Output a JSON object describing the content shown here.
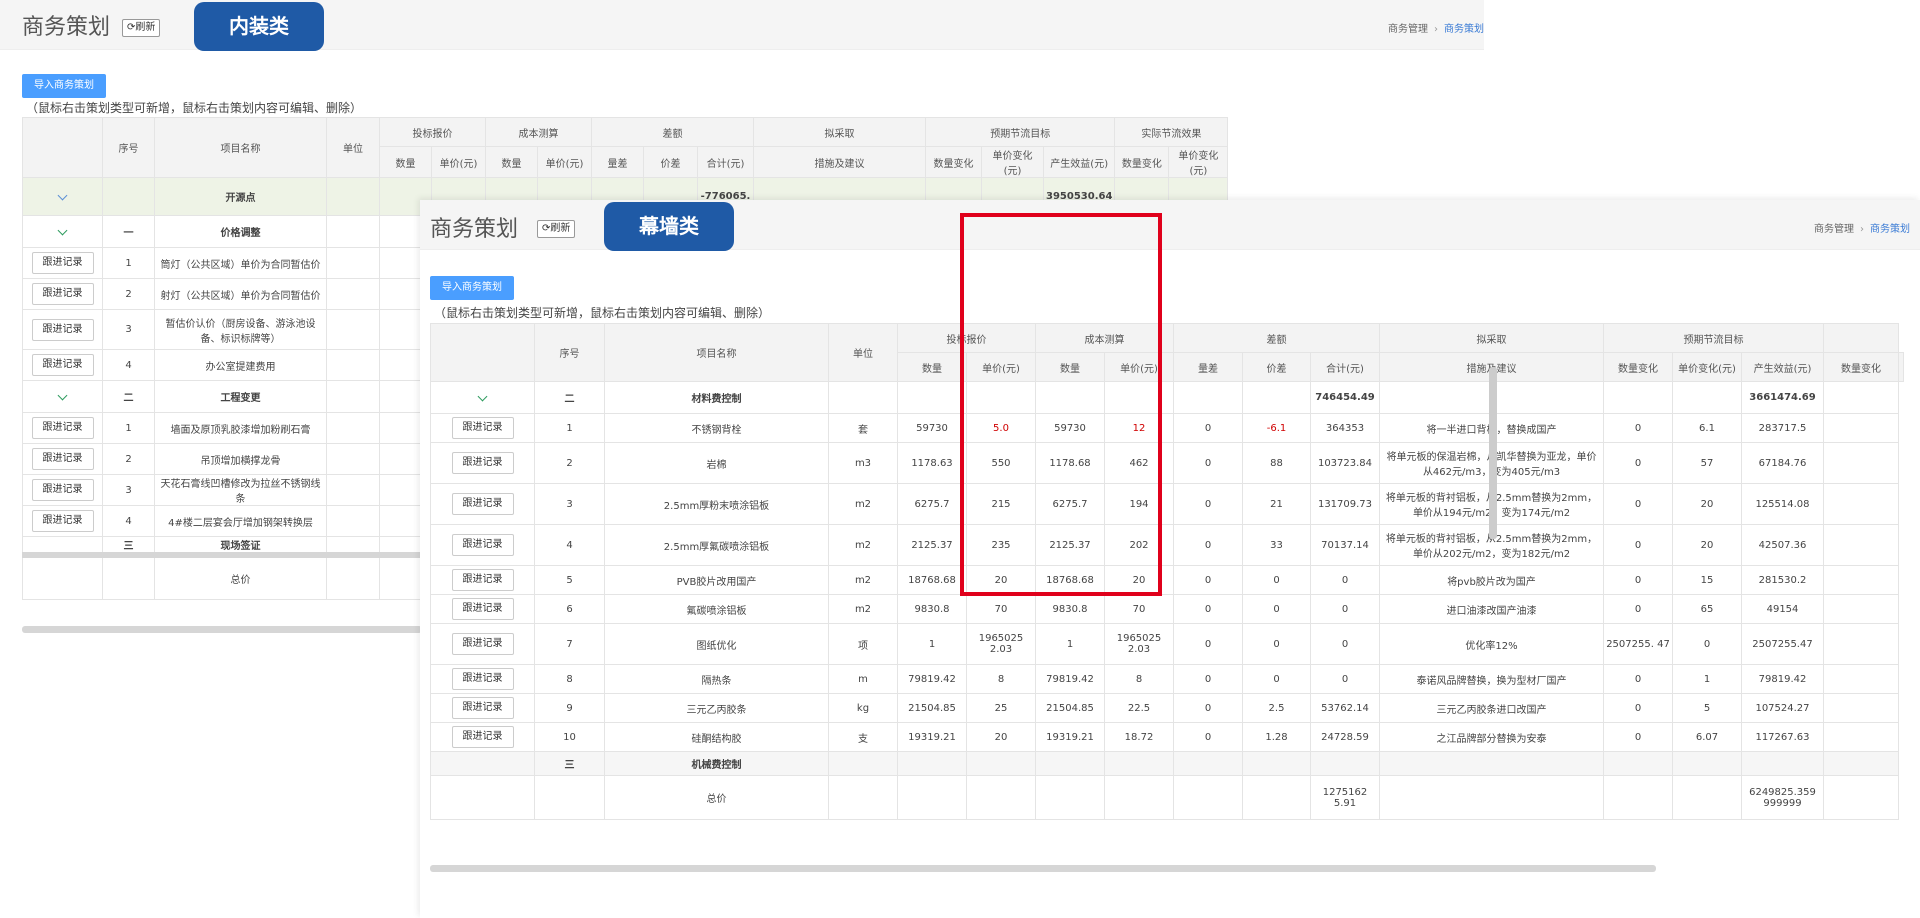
{
  "back": {
    "title": "商务策划",
    "refresh": "⟳刷新",
    "category": "内装类",
    "breadcrumb": [
      "商务管理",
      "商务策划"
    ],
    "import_label": "导入商务策划",
    "hint": "（鼠标右击策划类型可新增，鼠标右击策划内容可编辑、删除）",
    "headers": {
      "seq": "序号",
      "name": "项目名称",
      "unit": "单位",
      "groups": [
        "投标报价",
        "成本测算",
        "差额",
        "拟采取",
        "预期节流目标",
        "实际节流效果"
      ],
      "sub": [
        "数量",
        "单价(元)",
        "数量",
        "单价(元)",
        "量差",
        "价差",
        "合计(元)",
        "措施及建议",
        "数量变化",
        "单价变化(元)",
        "产生效益(元)",
        "数量变化",
        "单价变化(元)"
      ]
    },
    "top_row": {
      "name": "开源点",
      "total": "-776065.",
      "benefit": "3950530.64"
    },
    "rows": [
      {
        "kind": "group",
        "seq": "一",
        "name": "价格调整"
      },
      {
        "kind": "item",
        "btn": "跟进记录",
        "seq": "1",
        "name": "筒灯（公共区域）单价为合同暂估价"
      },
      {
        "kind": "item",
        "btn": "跟进记录",
        "seq": "2",
        "name": "射灯（公共区域）单价为合同暂估价"
      },
      {
        "kind": "item",
        "btn": "跟进记录",
        "seq": "3",
        "name": "暂估价认价（厨房设备、游泳池设备、标识标牌等）"
      },
      {
        "kind": "item",
        "btn": "跟进记录",
        "seq": "4",
        "name": "办公室提建费用"
      },
      {
        "kind": "group",
        "seq": "二",
        "name": "工程变更"
      },
      {
        "kind": "item",
        "btn": "跟进记录",
        "seq": "1",
        "name": "墙面及原顶乳胶漆增加粉刷石膏"
      },
      {
        "kind": "item",
        "btn": "跟进记录",
        "seq": "2",
        "name": "吊顶增加横撑龙骨"
      },
      {
        "kind": "item",
        "btn": "跟进记录",
        "seq": "3",
        "name": "天花石膏线凹槽修改为拉丝不锈钢线条"
      },
      {
        "kind": "item",
        "btn": "跟进记录",
        "seq": "4",
        "name": "4#楼二层宴会厅增加钢架转换层"
      },
      {
        "kind": "cut",
        "seq": "三",
        "name": "现场签证"
      }
    ],
    "total_label": "总价"
  },
  "front": {
    "title": "商务策划",
    "refresh": "⟳刷新",
    "category": "幕墙类",
    "breadcrumb": [
      "商务管理",
      "商务策划"
    ],
    "import_label": "导入商务策划",
    "hint": "（鼠标右击策划类型可新增，鼠标右击策划内容可编辑、删除）",
    "headers": {
      "seq": "序号",
      "name": "项目名称",
      "unit": "单位",
      "groups": [
        "投标报价",
        "成本测算",
        "差额",
        "拟采取",
        "预期节流目标"
      ],
      "sub": [
        "数量",
        "单价(元)",
        "数量",
        "单价(元)",
        "量差",
        "价差",
        "合计(元)",
        "措施及建议",
        "数量变化",
        "单价变化(元)",
        "产生效益(元)",
        "数量变化"
      ]
    },
    "section": {
      "seq": "二",
      "name": "材料费控制",
      "total": "746454.49",
      "benefit": "3661474.69"
    },
    "rows": [
      {
        "btn": "跟进记录",
        "seq": "1",
        "name": "不锈钢背栓",
        "unit": "套",
        "bid_qty": "59730",
        "bid_price": "5.0",
        "cost_qty": "59730",
        "cost_price": "12",
        "qty_diff": "0",
        "price_diff": "-6.1",
        "total": "364353",
        "measure": "将一半进口背栓，替换成国产",
        "qty_chg": "0",
        "price_chg": "6.1",
        "benefit": "283717.5",
        "red": true
      },
      {
        "btn": "跟进记录",
        "seq": "2",
        "name": "岩棉",
        "unit": "m3",
        "bid_qty": "1178.63",
        "bid_price": "550",
        "cost_qty": "1178.68",
        "cost_price": "462",
        "qty_diff": "0",
        "price_diff": "88",
        "total": "103723.84",
        "measure": "将单元板的保温岩棉，从凯华替换为亚龙，单价从462元/m3，变为405元/m3",
        "qty_chg": "0",
        "price_chg": "57",
        "benefit": "67184.76"
      },
      {
        "btn": "跟进记录",
        "seq": "3",
        "name": "2.5mm厚粉末喷涂铝板",
        "unit": "m2",
        "bid_qty": "6275.7",
        "bid_price": "215",
        "cost_qty": "6275.7",
        "cost_price": "194",
        "qty_diff": "0",
        "price_diff": "21",
        "total": "131709.73",
        "measure": "将单元板的背衬铝板，从2.5mm替换为2mm，单价从194元/m2，变为174元/m2",
        "qty_chg": "0",
        "price_chg": "20",
        "benefit": "125514.08"
      },
      {
        "btn": "跟进记录",
        "seq": "4",
        "name": "2.5mm厚氟碳喷涂铝板",
        "unit": "m2",
        "bid_qty": "2125.37",
        "bid_price": "235",
        "cost_qty": "2125.37",
        "cost_price": "202",
        "qty_diff": "0",
        "price_diff": "33",
        "total": "70137.14",
        "measure": "将单元板的背衬铝板，从2.5mm替换为2mm，单价从202元/m2，变为182元/m2",
        "qty_chg": "0",
        "price_chg": "20",
        "benefit": "42507.36"
      },
      {
        "btn": "跟进记录",
        "seq": "5",
        "name": "PVB胶片改用国产",
        "unit": "m2",
        "bid_qty": "18768.68",
        "bid_price": "20",
        "cost_qty": "18768.68",
        "cost_price": "20",
        "qty_diff": "0",
        "price_diff": "0",
        "total": "0",
        "measure": "将pvb胶片改为国产",
        "qty_chg": "0",
        "price_chg": "15",
        "benefit": "281530.2"
      },
      {
        "btn": "跟进记录",
        "seq": "6",
        "name": "氟碳喷涂铝板",
        "unit": "m2",
        "bid_qty": "9830.8",
        "bid_price": "70",
        "cost_qty": "9830.8",
        "cost_price": "70",
        "qty_diff": "0",
        "price_diff": "0",
        "total": "0",
        "measure": "进口油漆改国产油漆",
        "qty_chg": "0",
        "price_chg": "65",
        "benefit": "49154"
      },
      {
        "btn": "跟进记录",
        "seq": "7",
        "name": "图纸优化",
        "unit": "项",
        "bid_qty": "1",
        "bid_price": "1965025 2.03",
        "cost_qty": "1",
        "cost_price": "1965025 2.03",
        "qty_diff": "0",
        "price_diff": "0",
        "total": "0",
        "measure": "优化率12%",
        "qty_chg": "2507255. 47",
        "price_chg": "0",
        "benefit": "2507255.47"
      },
      {
        "btn": "跟进记录",
        "seq": "8",
        "name": "隔热条",
        "unit": "m",
        "bid_qty": "79819.42",
        "bid_price": "8",
        "cost_qty": "79819.42",
        "cost_price": "8",
        "qty_diff": "0",
        "price_diff": "0",
        "total": "0",
        "measure": "泰诺风品牌替换，换为型材厂国产",
        "qty_chg": "0",
        "price_chg": "1",
        "benefit": "79819.42"
      },
      {
        "btn": "跟进记录",
        "seq": "9",
        "name": "三元乙丙胶条",
        "unit": "kg",
        "bid_qty": "21504.85",
        "bid_price": "25",
        "cost_qty": "21504.85",
        "cost_price": "22.5",
        "qty_diff": "0",
        "price_diff": "2.5",
        "total": "53762.14",
        "measure": "三元乙丙胶条进口改国产",
        "qty_chg": "0",
        "price_chg": "5",
        "benefit": "107524.27"
      },
      {
        "btn": "跟进记录",
        "seq": "10",
        "name": "硅酮结构胶",
        "unit": "支",
        "bid_qty": "19319.21",
        "bid_price": "20",
        "cost_qty": "19319.21",
        "cost_price": "18.72",
        "qty_diff": "0",
        "price_diff": "1.28",
        "total": "24728.59",
        "measure": "之江品牌部分替换为安泰",
        "qty_chg": "0",
        "price_chg": "6.07",
        "benefit": "117267.63"
      }
    ],
    "next_section": {
      "seq": "三",
      "name": "机械费控制"
    },
    "total_row": {
      "label": "总价",
      "total": "1275162 5.91",
      "benefit": "6249825.359 999999"
    }
  },
  "colors": {
    "accent": "#4a9eff",
    "tag": "#1f5aa6",
    "highlight": "#e0001b",
    "group_bg": "#eef3e6",
    "negative": "#d00000"
  },
  "icons": {
    "expand": "chevron-down-icon",
    "refresh": "refresh-icon"
  }
}
